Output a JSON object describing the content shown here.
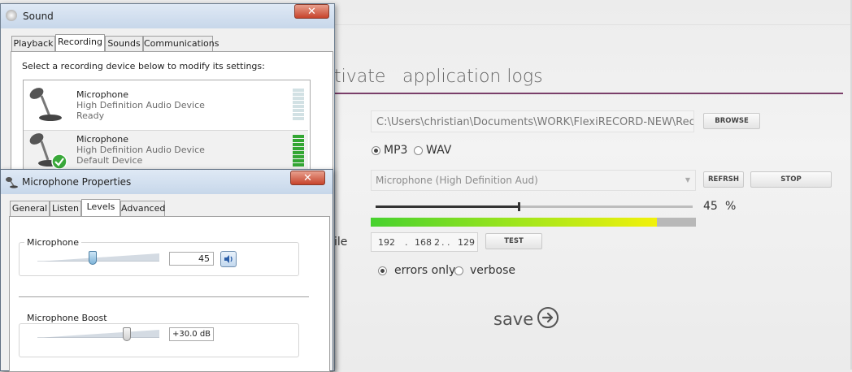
{
  "app": {
    "tab_activate": "tivate",
    "tab_logs": "application logs",
    "path_value": "C:\\Users\\christian\\Documents\\WORK\\FlexiRECORD-NEW\\Recor",
    "browse_label": "BROWSE",
    "format_mp3": "MP3",
    "format_wav": "WAV",
    "selected_format": "MP3",
    "mic_select_value": "Microphone (High Definition Aud)",
    "refresh_label": "REFRSH",
    "stop_label": "STOP",
    "volume_value": "45",
    "volume_unit": "%",
    "volume_fraction": 0.45,
    "level_fraction": 0.88,
    "ip": [
      "192",
      "168",
      "2",
      "129"
    ],
    "test_label": "TEST",
    "partial_label": "ile",
    "log_errors": "errors only",
    "log_verbose": "verbose",
    "selected_log": "errors only",
    "save_label": "save",
    "accent_color": "#7a3e6a"
  },
  "sound_window": {
    "title": "Sound",
    "tabs": [
      "Playback",
      "Recording",
      "Sounds",
      "Communications"
    ],
    "active_tab": "Recording",
    "instruction": "Select a recording device below to modify its settings:",
    "devices": [
      {
        "name": "Microphone",
        "desc": "High Definition Audio Device",
        "status": "Ready"
      },
      {
        "name": "Microphone",
        "desc": "High Definition Audio Device",
        "status": "Default Device"
      }
    ]
  },
  "mic_properties": {
    "title": "Microphone Properties",
    "tabs": [
      "General",
      "Listen",
      "Levels",
      "Advanced"
    ],
    "active_tab": "Levels",
    "mic_label": "Microphone",
    "mic_value": "45",
    "mic_fraction": 0.45,
    "boost_label": "Microphone Boost",
    "boost_value": "+30.0 dB",
    "boost_fraction": 0.75
  }
}
